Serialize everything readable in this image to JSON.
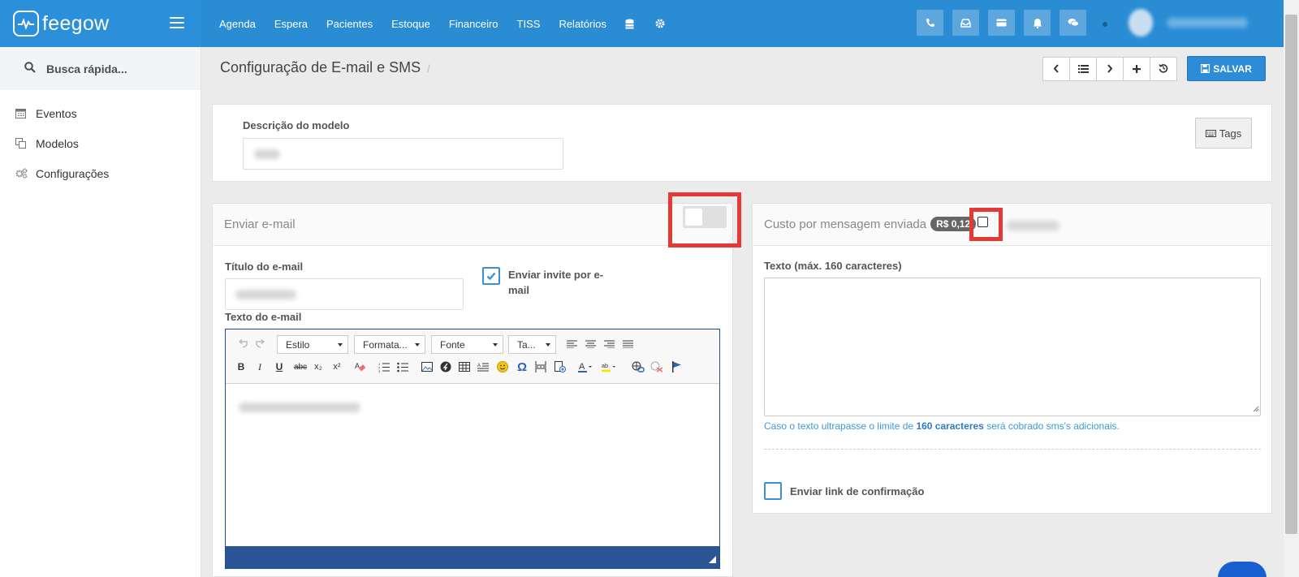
{
  "brand": {
    "name": "feegow"
  },
  "nav": [
    "Agenda",
    "Espera",
    "Pacientes",
    "Estoque",
    "Financeiro",
    "TISS",
    "Relatórios"
  ],
  "nav_icons": [
    "database-icon",
    "gear-icon"
  ],
  "top_icons": [
    "phone-icon",
    "inbox-icon",
    "card-icon",
    "bell-icon",
    "chat-icon"
  ],
  "sidebar": {
    "search_placeholder": "Busca rápida...",
    "items": [
      {
        "label": "Eventos",
        "icon": "calendar-icon"
      },
      {
        "label": "Modelos",
        "icon": "copy-icon"
      },
      {
        "label": "Configurações",
        "icon": "gears-icon"
      }
    ]
  },
  "header": {
    "title": "Configuração de E-mail e SMS",
    "separator": "/",
    "save_label": "SALVAR"
  },
  "model": {
    "desc_label": "Descrição do modelo",
    "tags_label": "Tags"
  },
  "email": {
    "panel_title": "Enviar e-mail",
    "title_label": "Título do e-mail",
    "invite_label": "Enviar invite por e-mail",
    "invite_checked": true,
    "text_label": "Texto do e-mail",
    "toolbar": {
      "style": "Estilo",
      "format": "Formata...",
      "font": "Fonte",
      "size": "Ta..."
    }
  },
  "sms": {
    "panel_title": "Custo por mensagem enviada",
    "price": "R$ 0,12",
    "text_label": "Texto (máx. 160 caracteres)",
    "help_prefix": "Caso o texto ultrapasse o limite de ",
    "help_bold": "160 caracteres",
    "help_suffix": " será cobrado sms's adicionais.",
    "confirm_label": "Enviar link de confirmação"
  }
}
